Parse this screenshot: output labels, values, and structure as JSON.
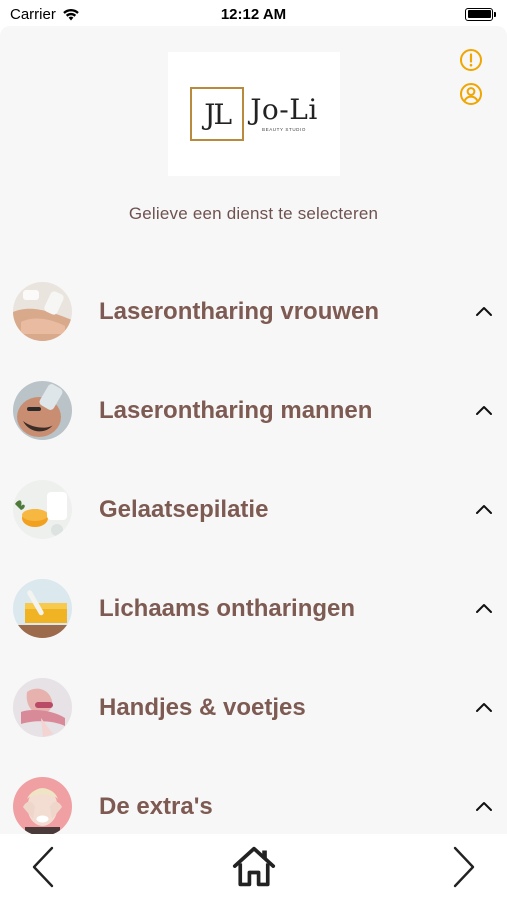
{
  "status_bar": {
    "carrier": "Carrier",
    "time": "12:12 AM"
  },
  "header": {
    "logo_mark": "JL",
    "logo_name": "Jo-Li",
    "logo_sub": "BEAUTY STUDIO",
    "accent_color": "#f0a500"
  },
  "subtitle": "Gelieve een dienst te selecteren",
  "services": [
    {
      "title": "Laserontharing vrouwen",
      "icon": "laser-women-thumbnail"
    },
    {
      "title": "Laserontharing mannen",
      "icon": "laser-men-thumbnail"
    },
    {
      "title": "Gelaatsepilatie",
      "icon": "face-epilation-thumbnail"
    },
    {
      "title": "Lichaams ontharingen",
      "icon": "body-waxing-thumbnail"
    },
    {
      "title": "Handjes & voetjes",
      "icon": "hands-feet-thumbnail"
    },
    {
      "title": "De extra's",
      "icon": "extras-thumbnail"
    }
  ],
  "bottom_nav": {
    "back_icon": "chevron-left-icon",
    "home_icon": "home-icon",
    "forward_icon": "chevron-right-icon"
  }
}
